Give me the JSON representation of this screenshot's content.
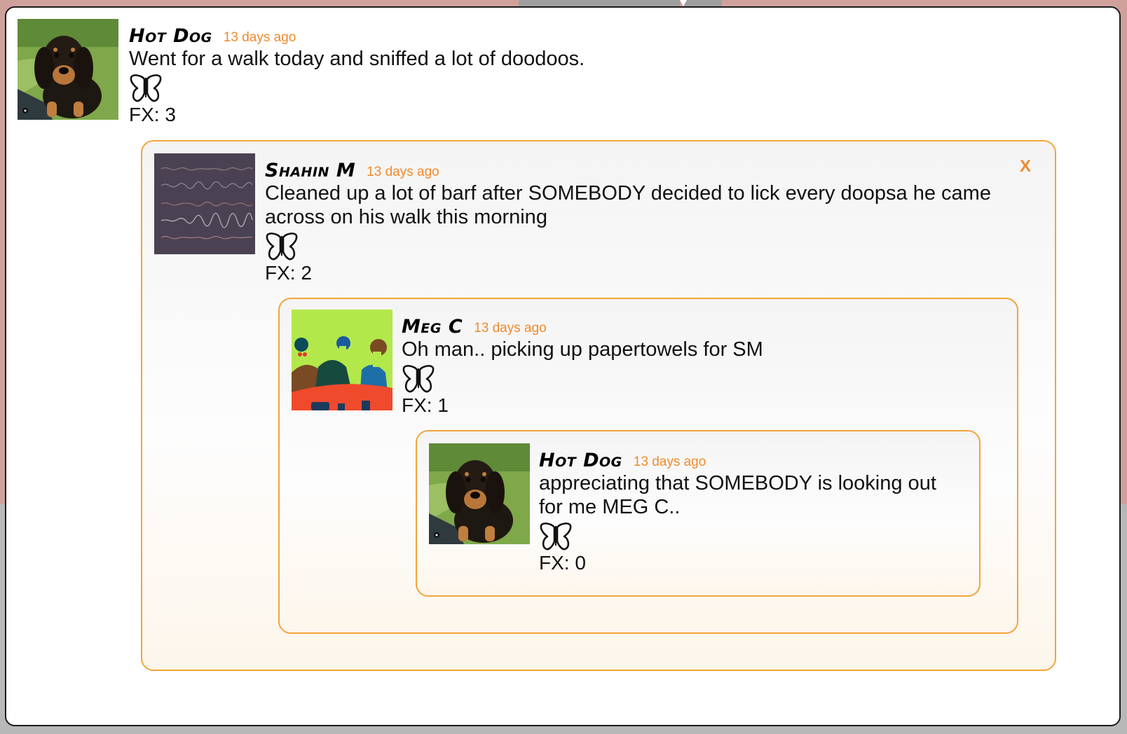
{
  "posts": [
    {
      "author": "Hot Dog",
      "time": "13 days ago",
      "message": "Went for a walk today and sniffed a lot of doodoos.",
      "fx_label": "FX:",
      "fx_count": "3",
      "avatar": "dachshund-puppy-photo",
      "like_icon": "butterfly-icon"
    },
    {
      "author": "Shahin M",
      "time": "13 days ago",
      "message": "Cleaned up a lot of barf after SOMEBODY decided to lick every doopsa he came across on his walk this morning",
      "fx_label": "FX:",
      "fx_count": "2",
      "avatar": "waveform-art",
      "like_icon": "butterfly-icon",
      "close_label": "X"
    },
    {
      "author": "Meg C",
      "time": "13 days ago",
      "message": "Oh man.. picking up papertowels for SM",
      "fx_label": "FX:",
      "fx_count": "1",
      "avatar": "three-people-illustration",
      "like_icon": "butterfly-icon"
    },
    {
      "author": "Hot Dog",
      "time": "13 days ago",
      "message": "appreciating that SOMEBODY is looking out for me MEG C..",
      "fx_label": "FX:",
      "fx_count": "0",
      "avatar": "dachshund-puppy-photo",
      "like_icon": "butterfly-icon"
    }
  ],
  "colors": {
    "accent": "#f08a2c",
    "reply_border": "#f3a43a",
    "page_background": "#d0a19b"
  }
}
